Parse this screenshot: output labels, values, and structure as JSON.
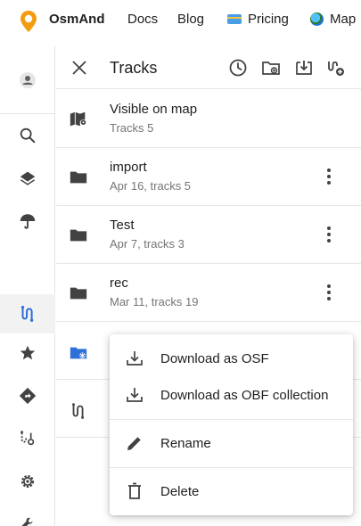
{
  "nav": {
    "brand": "OsmAnd",
    "docs": "Docs",
    "blog": "Blog",
    "pricing": "Pricing",
    "map": "Map",
    "logo_color": "#f39c12"
  },
  "sidebar": {
    "items": [
      {
        "icon": "account-icon"
      },
      {
        "icon": "search-icon"
      },
      {
        "icon": "layers-icon"
      },
      {
        "icon": "weather-umbrella-icon"
      },
      {
        "icon": "tracks-route-icon",
        "active": true
      },
      {
        "icon": "favorites-star-icon"
      },
      {
        "icon": "navigation-directions-icon"
      },
      {
        "icon": "planning-route-icon"
      },
      {
        "icon": "settings-gear-icon"
      },
      {
        "icon": "tools-wrench-icon"
      }
    ],
    "accent": "#2f6fd8"
  },
  "panel": {
    "title": "Tracks",
    "header_buttons": [
      "history-clock-icon",
      "folder-add-icon",
      "import-download-icon",
      "create-track-icon"
    ]
  },
  "rows": [
    {
      "title": "Visible on map",
      "subtitle": "Tracks 5",
      "icon": "map-visible-icon"
    },
    {
      "title": "import",
      "subtitle": "Apr 16, tracks 5",
      "icon": "folder-icon"
    },
    {
      "title": "Test",
      "subtitle": "Apr 7, tracks 3",
      "icon": "folder-icon"
    },
    {
      "title": "rec",
      "subtitle": "Mar 11, tracks 19",
      "icon": "folder-icon"
    }
  ],
  "menu": {
    "items": [
      {
        "label": "Download as OSF",
        "icon": "download-icon"
      },
      {
        "label": "Download as OBF collection",
        "icon": "download-icon"
      },
      {
        "label": "Rename",
        "icon": "pencil-icon"
      },
      {
        "label": "Delete",
        "icon": "trash-icon"
      }
    ]
  }
}
